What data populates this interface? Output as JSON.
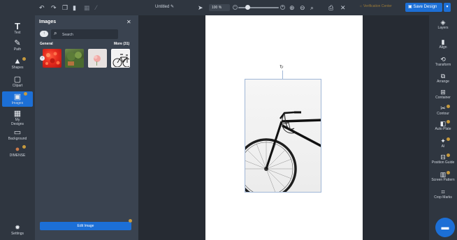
{
  "toolbar": {
    "icons": [
      "undo-icon",
      "redo-icon",
      "copy-icon",
      "delete-icon",
      "grid-icon",
      "pencil-icon"
    ],
    "document_title": "Untitled",
    "zoom_value": "100",
    "zoom_unit": "%",
    "verification": "Verification Center",
    "save_label": "Save Design",
    "save_dropdown": "▾"
  },
  "left_sidebar": {
    "items": [
      {
        "label": "Text",
        "icon": "text-icon",
        "glyph": "T"
      },
      {
        "label": "Path",
        "icon": "path-icon",
        "glyph": "✎"
      },
      {
        "label": "Shapes",
        "icon": "shapes-icon",
        "glyph": "▲"
      },
      {
        "label": "Clipart",
        "icon": "clipart-icon",
        "glyph": "▢"
      },
      {
        "label": "Images",
        "icon": "images-icon",
        "glyph": "▣"
      },
      {
        "label": "My Designs",
        "icon": "my-designs-icon",
        "glyph": "▦"
      },
      {
        "label": "Background",
        "icon": "background-icon",
        "glyph": "▭"
      },
      {
        "label": "DIMENSE",
        "icon": "dimense-icon",
        "glyph": "●"
      }
    ],
    "settings_label": "Settings"
  },
  "images_panel": {
    "title": "Images",
    "search_placeholder": "Search",
    "category_label": "General",
    "more_label": "More (31)",
    "thumbnails": [
      "red-abstract-thumbnail",
      "green-garden-thumbnail",
      "pink-flower-thumbnail",
      "bicycle-thumbnail"
    ],
    "edit_button": "Edit Image"
  },
  "right_sidebar": {
    "items": [
      {
        "label": "Layers",
        "icon": "layers-icon",
        "glyph": "◈"
      },
      {
        "label": "Align",
        "icon": "align-icon",
        "glyph": "▮"
      },
      {
        "label": "Transform",
        "icon": "transform-icon",
        "glyph": "⟲"
      },
      {
        "label": "Arrange",
        "icon": "arrange-icon",
        "glyph": "⧉"
      },
      {
        "label": "Container",
        "icon": "container-icon",
        "glyph": "⊞"
      },
      {
        "label": "Contour",
        "icon": "contour-icon",
        "glyph": "✂"
      },
      {
        "label": "Auto Plate",
        "icon": "auto-plate-icon",
        "glyph": "◧"
      },
      {
        "label": "AI",
        "icon": "ai-icon",
        "glyph": "✦"
      },
      {
        "label": "Position Guide",
        "icon": "position-guide-icon",
        "glyph": "⊟"
      },
      {
        "label": "Screen Pattern",
        "icon": "screen-pattern-icon",
        "glyph": "▥"
      },
      {
        "label": "Crop Marks",
        "icon": "crop-marks-icon",
        "glyph": "⌗"
      }
    ]
  },
  "colors": {
    "accent": "#1c6fd6",
    "badge": "#c69a3e",
    "toolbar_bg": "#2f3640",
    "panel_bg": "#3a4350",
    "workspace_bg": "#262b33"
  }
}
